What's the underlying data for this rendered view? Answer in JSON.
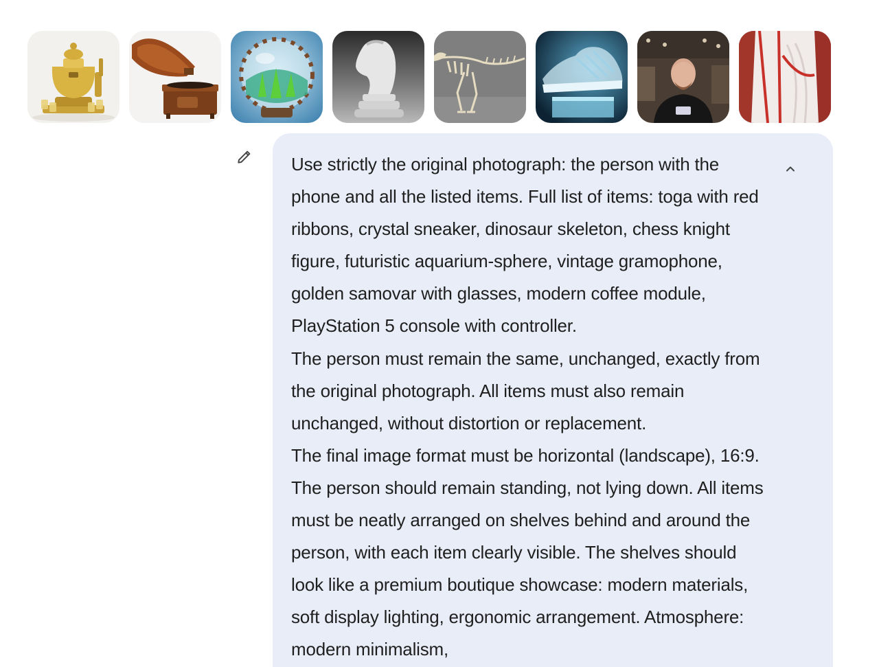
{
  "attachments": [
    {
      "subject": "golden samovar with glasses"
    },
    {
      "subject": "vintage gramophone"
    },
    {
      "subject": "futuristic aquarium-sphere"
    },
    {
      "subject": "chess knight figure"
    },
    {
      "subject": "dinosaur skeleton"
    },
    {
      "subject": "crystal sneaker"
    },
    {
      "subject": "person with phone"
    },
    {
      "subject": "toga with red ribbons"
    }
  ],
  "message": {
    "paragraphs": [
      "Use strictly the original photograph: the person with the phone and all the listed items. Full list of items: toga with red ribbons, crystal sneaker, dinosaur skeleton, chess knight figure, futuristic aquarium-sphere, vintage gramophone, golden samovar with glasses, modern coffee module, PlayStation 5 console with controller.",
      "The person must remain the same, unchanged, exactly from the original photograph. All items must also remain unchanged, without distortion or replacement.",
      "The final image format must be horizontal (landscape), 16:9. The person should remain standing, not lying down. All items must be neatly arranged on shelves behind and around the person, with each item clearly visible. The shelves should look like a premium boutique showcase: modern materials, soft display lighting, ergonomic arrangement. Atmosphere: modern minimalism,"
    ]
  },
  "icons": {
    "edit": "pencil-icon",
    "collapse": "chevron-up-icon"
  },
  "colors": {
    "bubble_bg": "#e8edf8",
    "text": "#1f1f1f",
    "icon": "#444746"
  }
}
